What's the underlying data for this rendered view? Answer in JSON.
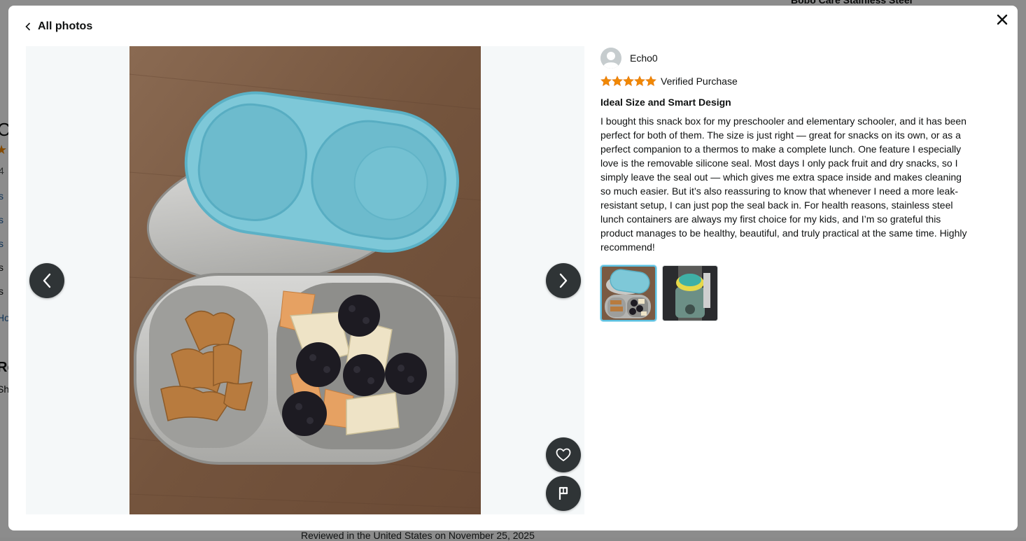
{
  "background_page": {
    "fragments": [
      {
        "text": "Co",
        "style": "big"
      },
      {
        "text": "4",
        "style": "muted"
      },
      {
        "text": "s",
        "style": "link"
      },
      {
        "text": "s",
        "style": "link"
      },
      {
        "text": "s",
        "style": "link"
      },
      {
        "text": "s",
        "style": "plain"
      },
      {
        "text": "s",
        "style": "plain"
      },
      {
        "text": "Ho",
        "style": "link"
      },
      {
        "text": "Re",
        "style": "big"
      },
      {
        "text": "Sha",
        "style": "plain"
      }
    ],
    "top_right_text": "Bobo Care Stainless Steel",
    "footer_text": "Reviewed in the United States on November 25, 2025"
  },
  "modal": {
    "back_label": "All photos",
    "close_icon": "close-icon",
    "viewer": {
      "prev_icon": "chevron-left-icon",
      "next_icon": "chevron-right-icon",
      "like_icon": "heart-icon",
      "report_icon": "flag-icon"
    },
    "review": {
      "reviewer_name": "Echo0",
      "rating": 5,
      "rating_max": 5,
      "star_color": "#f08804",
      "verified_label": "Verified Purchase",
      "title": "Ideal Size and Smart Design",
      "body": "I bought this snack box for my preschooler and elementary schooler, and it has been perfect for both of them. The size is just right — great for snacks on its own, or as a perfect companion to a thermos to make a complete lunch. One feature I especially love is the removable silicone seal. Most days I only pack fruit and dry snacks, so I simply leave the seal out — which gives me extra space inside and makes cleaning so much easier. But it’s also reassuring to know that whenever I need a more leak-resistant setup, I can just pop the seal back in. For health reasons, stainless steel lunch containers are always my first choice for my kids, and I’m so grateful this product manages to be healthy, beautiful, and truly practical at the same time. Highly recommend!",
      "thumbnails": [
        {
          "name": "thumbnail-lunchbox-open",
          "selected": true
        },
        {
          "name": "thumbnail-thermos-bag",
          "selected": false
        }
      ]
    }
  }
}
